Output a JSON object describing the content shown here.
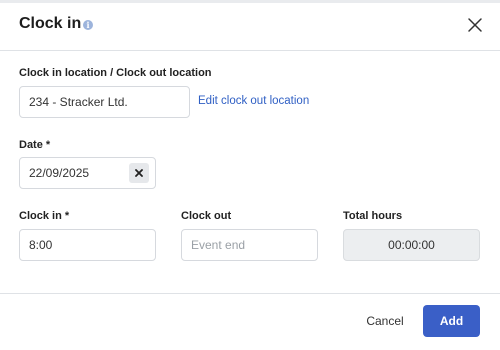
{
  "dialog": {
    "title": "Clock in",
    "info_icon": "i"
  },
  "location": {
    "label": "Clock in location / Clock out location",
    "value": "234 - Stracker Ltd.",
    "edit_link": "Edit clock out location"
  },
  "date": {
    "label": "Date *",
    "value": "22/09/2025"
  },
  "clock_in": {
    "label": "Clock in *",
    "value": "8:00"
  },
  "clock_out": {
    "label": "Clock out",
    "placeholder": "Event end"
  },
  "total_hours": {
    "label": "Total hours",
    "value": "00:00:00"
  },
  "footer": {
    "cancel_label": "Cancel",
    "add_label": "Add"
  },
  "colors": {
    "accent": "#3a5fc7",
    "link": "#2f5fc4",
    "info_icon": "#9db4dc"
  },
  "icons": [
    "info-icon",
    "close-icon",
    "clear-icon"
  ]
}
